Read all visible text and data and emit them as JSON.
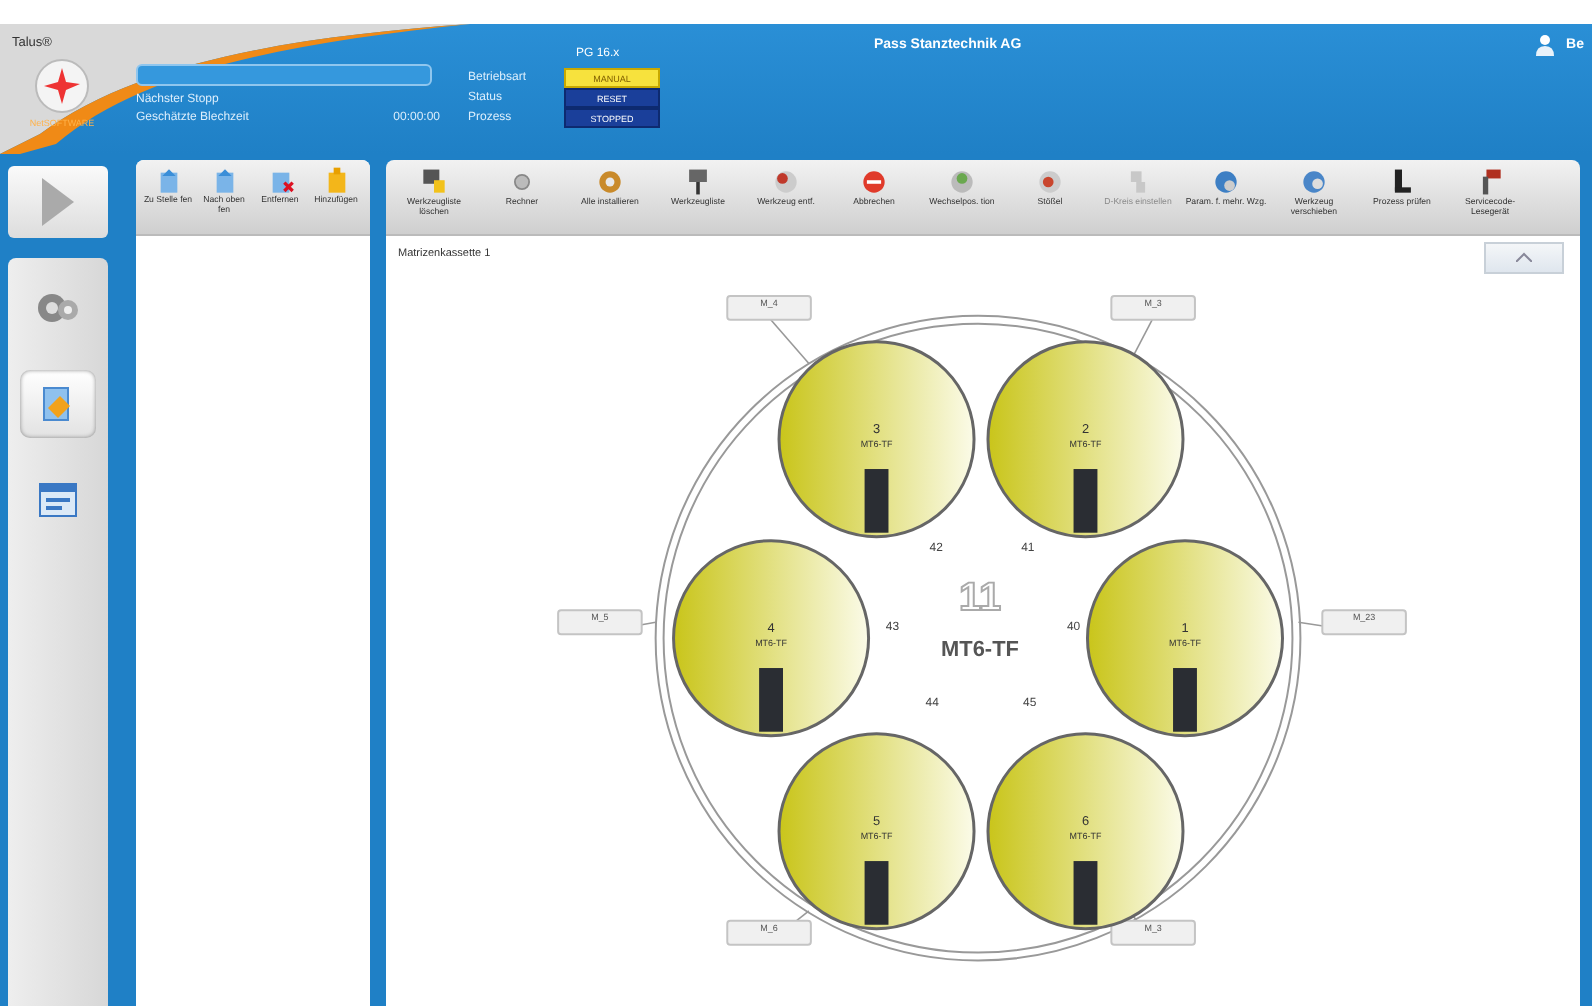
{
  "header": {
    "app_name": "Talus®",
    "logo_text": "NetSOFTWARE",
    "next_stop_label": "Nächster Stopp",
    "sheet_time_label": "Geschätzte Blechzeit",
    "sheet_time": "00:00:00",
    "machine": "PG 16.x",
    "company": "Pass Stanztechnik AG",
    "user": "Be",
    "status_rows": [
      {
        "label": "Betriebsart",
        "value": "MANUAL",
        "selected": true
      },
      {
        "label": "Status",
        "value": "RESET",
        "selected": false
      },
      {
        "label": "Prozess",
        "value": "STOPPED",
        "selected": false
      }
    ]
  },
  "sidebar": {
    "items": [
      {
        "selected": false
      },
      {
        "selected": true
      },
      {
        "selected": false
      }
    ]
  },
  "list_toolbar": [
    {
      "label": "Zu Stelle fen"
    },
    {
      "label": "Nach oben fen"
    },
    {
      "label": "Entfernen"
    },
    {
      "label": "Hinzufügen"
    }
  ],
  "toolbar": [
    {
      "label": "Werkzeugliste löschen",
      "disabled": false
    },
    {
      "label": "Rechner",
      "disabled": false
    },
    {
      "label": "Alle installieren",
      "disabled": false
    },
    {
      "label": "Werkzeugliste",
      "disabled": false
    },
    {
      "label": "Werkzeug entf.",
      "disabled": false
    },
    {
      "label": "Abbrechen",
      "disabled": false
    },
    {
      "label": "Wechselpos. tion",
      "disabled": false
    },
    {
      "label": "Stößel",
      "disabled": false
    },
    {
      "label": "D-Kreis einstellen",
      "disabled": true
    },
    {
      "label": "Param. f. mehr. Wzg.",
      "disabled": false
    },
    {
      "label": "Werkzeug verschieben",
      "disabled": false
    },
    {
      "label": "Prozess prüfen",
      "disabled": false
    },
    {
      "label": "Servicecode-Lesegerät",
      "disabled": false
    }
  ],
  "cassette": {
    "title": "Matrizenkassette 1",
    "center_number": "11",
    "center_tool": "MT6-TF",
    "stations": [
      {
        "number": "3",
        "tool": "MT6-TF",
        "slot": "42"
      },
      {
        "number": "2",
        "tool": "MT6-TF",
        "slot": "41"
      },
      {
        "number": "4",
        "tool": "MT6-TF",
        "slot": "43"
      },
      {
        "number": "1",
        "tool": "MT6-TF",
        "slot": "40"
      },
      {
        "number": "5",
        "tool": "MT6-TF",
        "slot": "44"
      },
      {
        "number": "6",
        "tool": "MT6-TF",
        "slot": "45"
      }
    ],
    "ports": [
      "M_4",
      "M_3",
      "M_5",
      "M_23",
      "M_6",
      "M_3"
    ]
  }
}
